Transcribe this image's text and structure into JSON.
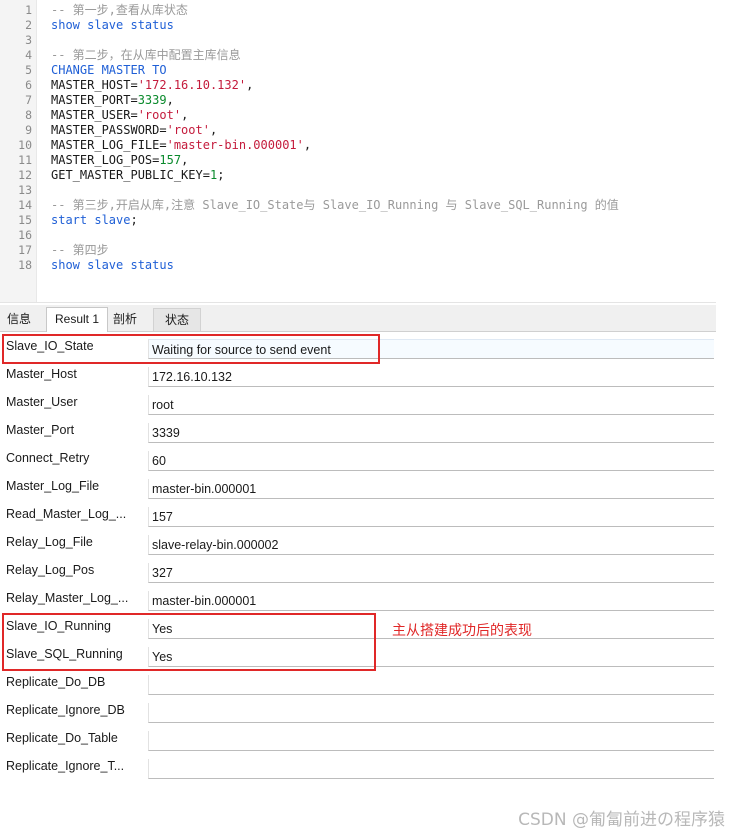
{
  "editor": {
    "lines": [
      {
        "n": "1",
        "parts": [
          {
            "t": "-- 第一步,查看从库状态",
            "c": "comment"
          }
        ]
      },
      {
        "n": "2",
        "parts": [
          {
            "t": "show slave status",
            "c": "kw"
          }
        ]
      },
      {
        "n": "3",
        "parts": []
      },
      {
        "n": "4",
        "parts": [
          {
            "t": "-- 第二步，在从库中配置主库信息",
            "c": "comment"
          }
        ]
      },
      {
        "n": "5",
        "parts": [
          {
            "t": "CHANGE MASTER TO",
            "c": "kw"
          }
        ]
      },
      {
        "n": "6",
        "parts": [
          {
            "t": "MASTER_HOST=",
            "c": "plain"
          },
          {
            "t": "'172.16.10.132'",
            "c": "str"
          },
          {
            "t": ",",
            "c": "plain"
          }
        ]
      },
      {
        "n": "7",
        "parts": [
          {
            "t": "MASTER_PORT=",
            "c": "plain"
          },
          {
            "t": "3339",
            "c": "num"
          },
          {
            "t": ",",
            "c": "plain"
          }
        ]
      },
      {
        "n": "8",
        "parts": [
          {
            "t": "MASTER_USER=",
            "c": "plain"
          },
          {
            "t": "'root'",
            "c": "str"
          },
          {
            "t": ",",
            "c": "plain"
          }
        ]
      },
      {
        "n": "9",
        "parts": [
          {
            "t": "MASTER_PASSWORD=",
            "c": "plain"
          },
          {
            "t": "'root'",
            "c": "str"
          },
          {
            "t": ",",
            "c": "plain"
          }
        ]
      },
      {
        "n": "10",
        "parts": [
          {
            "t": "MASTER_LOG_FILE=",
            "c": "plain"
          },
          {
            "t": "'master-bin.000001'",
            "c": "str"
          },
          {
            "t": ",",
            "c": "plain"
          }
        ]
      },
      {
        "n": "11",
        "parts": [
          {
            "t": "MASTER_LOG_POS=",
            "c": "plain"
          },
          {
            "t": "157",
            "c": "num"
          },
          {
            "t": ",",
            "c": "plain"
          }
        ]
      },
      {
        "n": "12",
        "parts": [
          {
            "t": "GET_MASTER_PUBLIC_KEY=",
            "c": "plain"
          },
          {
            "t": "1",
            "c": "num"
          },
          {
            "t": ";",
            "c": "plain"
          }
        ]
      },
      {
        "n": "13",
        "parts": []
      },
      {
        "n": "14",
        "parts": [
          {
            "t": "-- 第三步,开启从库,注意 Slave_IO_State与 Slave_IO_Running 与 Slave_SQL_Running 的值",
            "c": "comment"
          }
        ]
      },
      {
        "n": "15",
        "parts": [
          {
            "t": "start slave",
            "c": "kw"
          },
          {
            "t": ";",
            "c": "plain"
          }
        ]
      },
      {
        "n": "16",
        "parts": []
      },
      {
        "n": "17",
        "parts": [
          {
            "t": "-- 第四步",
            "c": "comment"
          }
        ]
      },
      {
        "n": "18",
        "parts": [
          {
            "t": "show slave status",
            "c": "kw"
          }
        ]
      }
    ]
  },
  "tabs": [
    "信息",
    "Result 1",
    "剖析",
    "状态"
  ],
  "active_tab": "Result 1",
  "result": {
    "rows": [
      {
        "field": "Slave_IO_State",
        "value": "Waiting for source to send event"
      },
      {
        "field": "Master_Host",
        "value": "172.16.10.132"
      },
      {
        "field": "Master_User",
        "value": "root"
      },
      {
        "field": "Master_Port",
        "value": "3339"
      },
      {
        "field": "Connect_Retry",
        "value": "60"
      },
      {
        "field": "Master_Log_File",
        "value": "master-bin.000001"
      },
      {
        "field": "Read_Master_Log_...",
        "value": "157"
      },
      {
        "field": "Relay_Log_File",
        "value": "slave-relay-bin.000002"
      },
      {
        "field": "Relay_Log_Pos",
        "value": "327"
      },
      {
        "field": "Relay_Master_Log_...",
        "value": "master-bin.000001"
      },
      {
        "field": "Slave_IO_Running",
        "value": "Yes"
      },
      {
        "field": "Slave_SQL_Running",
        "value": "Yes"
      },
      {
        "field": "Replicate_Do_DB",
        "value": ""
      },
      {
        "field": "Replicate_Ignore_DB",
        "value": ""
      },
      {
        "field": "Replicate_Do_Table",
        "value": ""
      },
      {
        "field": "Replicate_Ignore_T...",
        "value": ""
      }
    ]
  },
  "annotation": "主从搭建成功后的表现",
  "watermark": "CSDN @匍匐前进の程序猿",
  "colors": {
    "highlight": "#e02828",
    "keyword": "#1f5fd6",
    "string": "#c41b3c",
    "number": "#0a8a2c",
    "comment": "#9a9a9a"
  }
}
